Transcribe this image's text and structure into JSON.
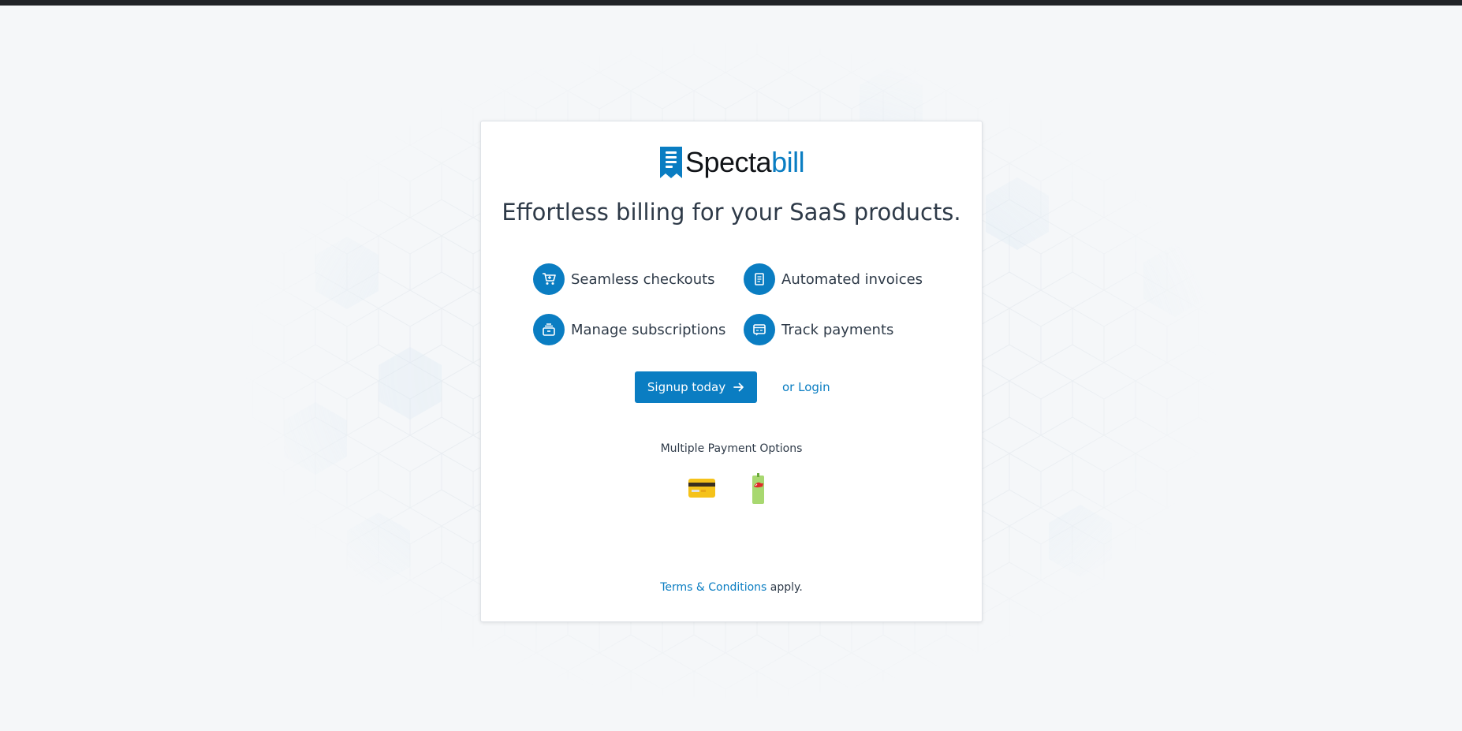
{
  "brand": {
    "name_dark": "Specta",
    "name_blue": "bill",
    "accent_color": "#0a7dc2"
  },
  "hero": {
    "tagline": "Effortless billing for your SaaS products."
  },
  "features": [
    {
      "label": "Seamless checkouts",
      "icon": "cart-icon"
    },
    {
      "label": "Automated invoices",
      "icon": "invoice-icon"
    },
    {
      "label": "Manage subscriptions",
      "icon": "subscription-box-icon"
    },
    {
      "label": "Track payments",
      "icon": "payment-tracker-icon"
    }
  ],
  "actions": {
    "signup_label": "Signup today",
    "login_label": "or Login"
  },
  "payments": {
    "title": "Multiple Payment Options",
    "options": [
      {
        "icon": "credit-card-icon"
      },
      {
        "icon": "mobile-money-icon"
      }
    ]
  },
  "footer": {
    "terms_link": "Terms & Conditions",
    "terms_suffix": " apply."
  }
}
